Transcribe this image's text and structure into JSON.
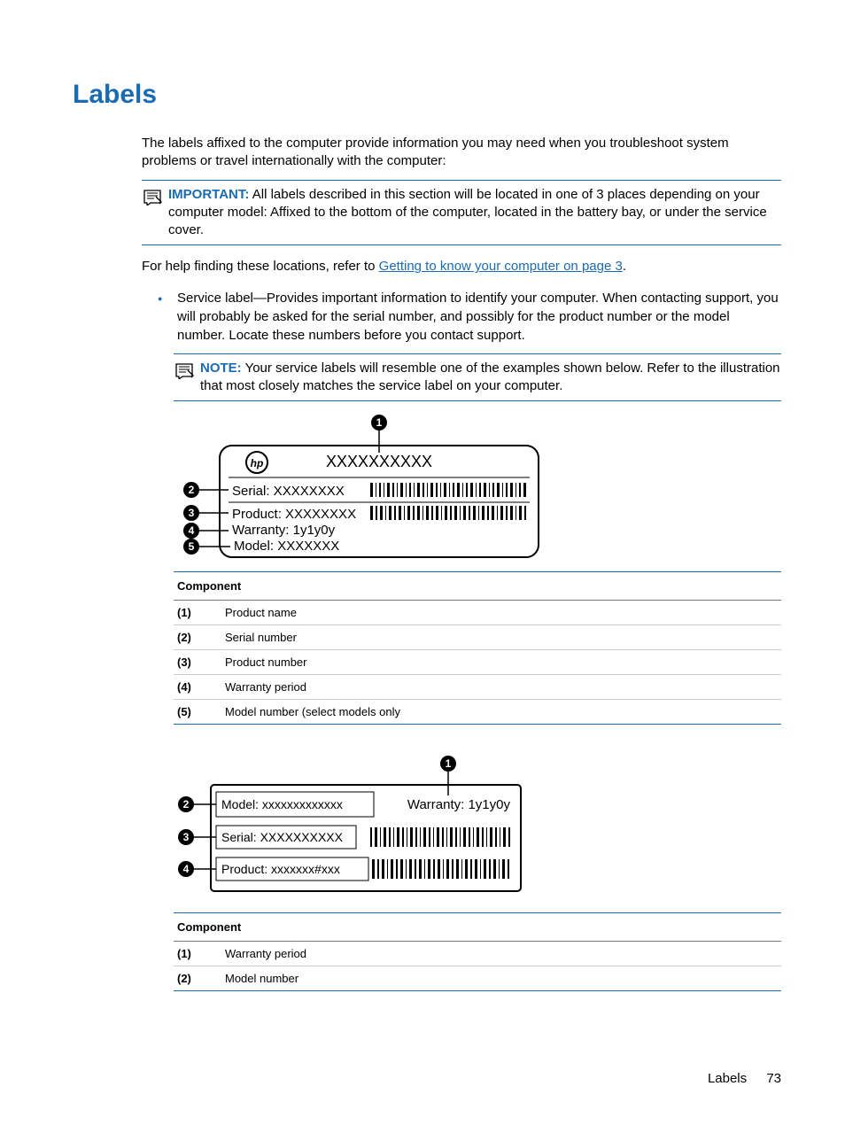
{
  "heading": "Labels",
  "intro": "The labels affixed to the computer provide information you may need when you troubleshoot system problems or travel internationally with the computer:",
  "important": {
    "label": "IMPORTANT:",
    "text": "All labels described in this section will be located in one of 3 places depending on your computer model: Affixed to the bottom of the computer, located in the battery bay, or under the service cover."
  },
  "help_prefix": "For help finding these locations, refer to ",
  "help_link": "Getting to know your computer on page 3",
  "help_suffix": ".",
  "bullet": "Service label—Provides important information to identify your computer. When contacting support, you will probably be asked for the serial number, and possibly for the product number or the model number. Locate these numbers before you contact support.",
  "note": {
    "label": "NOTE:",
    "text": "Your service labels will resemble one of the examples shown below. Refer to the illustration that most closely matches the service label on your computer."
  },
  "diagram1": {
    "product_top": "XXXXXXXXXX",
    "serial": "Serial:  XXXXXXXX",
    "product": "Product: XXXXXXXX",
    "warranty": "Warranty: 1y1y0y",
    "model": "Model: XXXXXXX"
  },
  "table1": {
    "header": "Component",
    "rows": [
      {
        "idx": "(1)",
        "desc": "Product name"
      },
      {
        "idx": "(2)",
        "desc": "Serial number"
      },
      {
        "idx": "(3)",
        "desc": "Product number"
      },
      {
        "idx": "(4)",
        "desc": "Warranty period"
      },
      {
        "idx": "(5)",
        "desc": "Model number (select models only"
      }
    ]
  },
  "diagram2": {
    "model": "Model: xxxxxxxxxxxxx",
    "warranty": "Warranty: 1y1y0y",
    "serial": "Serial: XXXXXXXXXX",
    "product": "Product: xxxxxxx#xxx"
  },
  "table2": {
    "header": "Component",
    "rows": [
      {
        "idx": "(1)",
        "desc": "Warranty period"
      },
      {
        "idx": "(2)",
        "desc": "Model number"
      }
    ]
  },
  "footer": {
    "section": "Labels",
    "page": "73"
  }
}
